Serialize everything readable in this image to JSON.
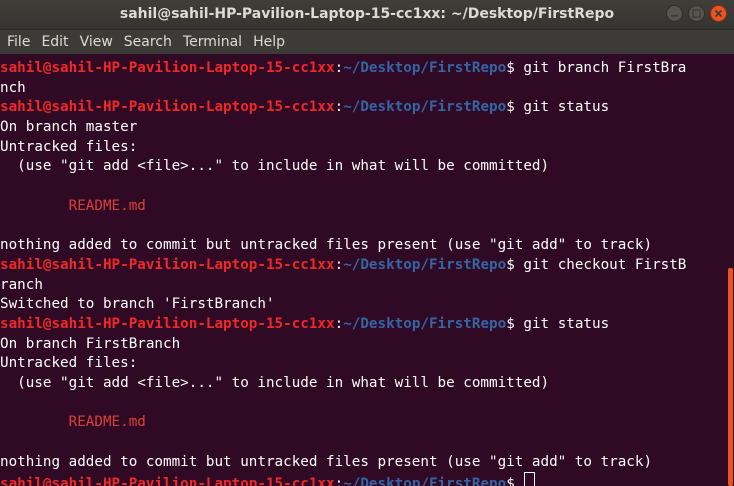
{
  "window": {
    "title": "sahil@sahil-HP-Pavilion-Laptop-15-cc1xx: ~/Desktop/FirstRepo"
  },
  "menu": [
    "File",
    "Edit",
    "View",
    "Search",
    "Terminal",
    "Help"
  ],
  "prompt": {
    "user": "sahil@sahil-HP-Pavilion-Laptop-15-cc1xx",
    "colon": ":",
    "path": "~/Desktop/FirstRepo",
    "end": "$ "
  },
  "lines": {
    "l1_cmd": "git branch FirstBra",
    "l2": "nch",
    "l3_cmd": "git status",
    "l4": "On branch master",
    "l5": "Untracked files:",
    "l6": "  (use \"git add <file>...\" to include in what will be committed)",
    "l7": "",
    "l8": "README.md",
    "l9": "",
    "l10": "nothing added to commit but untracked files present (use \"git add\" to track)",
    "l11_cmd": "git checkout FirstB",
    "l12": "ranch",
    "l13": "Switched to branch 'FirstBranch'",
    "l14_cmd": "git status",
    "l15": "On branch FirstBranch",
    "l16": "Untracked files:",
    "l17": "  (use \"git add <file>...\" to include in what will be committed)",
    "l18": "",
    "l19": "README.md",
    "l20": "",
    "l21": "nothing added to commit but untracked files present (use \"git add\" to track)",
    "l22_cmd": ""
  },
  "colors": {
    "background": "#300a24",
    "prompt_user": "#ef2929",
    "prompt_path": "#3465a4",
    "untracked_file": "#d9403a",
    "text": "#ffffff",
    "close_button": "#e95420",
    "scrollbar": "#e95420"
  }
}
